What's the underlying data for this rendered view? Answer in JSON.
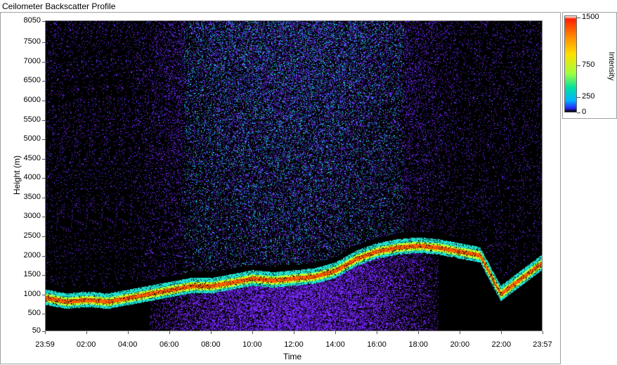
{
  "window": {
    "title": "Ceilometer Backscatter Profile"
  },
  "colors": {
    "background": "#000000",
    "accent": "#7a28ff"
  },
  "chart_data": {
    "type": "heatmap",
    "title": "Ceilometer Backscatter Profile",
    "xlabel": "Time",
    "ylabel": "Height (m)",
    "x_ticks": [
      "23:59",
      "02:00",
      "04:00",
      "06:00",
      "08:00",
      "10:00",
      "12:00",
      "14:00",
      "16:00",
      "18:00",
      "20:00",
      "22:00",
      "23:57"
    ],
    "y_ticks": [
      8050,
      7500,
      7000,
      6500,
      6000,
      5500,
      5000,
      4500,
      4000,
      3500,
      3000,
      2500,
      2000,
      1500,
      1000,
      500,
      50
    ],
    "ylim": [
      50,
      8050
    ],
    "colorbar": {
      "title": "Intensity",
      "ticks": [
        1500,
        750,
        250,
        0
      ],
      "range": [
        0,
        1500
      ]
    },
    "cloud_base_profile": {
      "time_hours": [
        0,
        1,
        2,
        3,
        4,
        5,
        6,
        7,
        8,
        9,
        10,
        11,
        12,
        13,
        14,
        15,
        16,
        17,
        18,
        19,
        20,
        21,
        22,
        23
      ],
      "height_m": [
        900,
        800,
        850,
        800,
        900,
        1000,
        1100,
        1200,
        1200,
        1300,
        1400,
        1350,
        1400,
        1450,
        1600,
        1900,
        2100,
        2200,
        2250,
        2200,
        2100,
        2000,
        1000,
        1400
      ]
    }
  }
}
